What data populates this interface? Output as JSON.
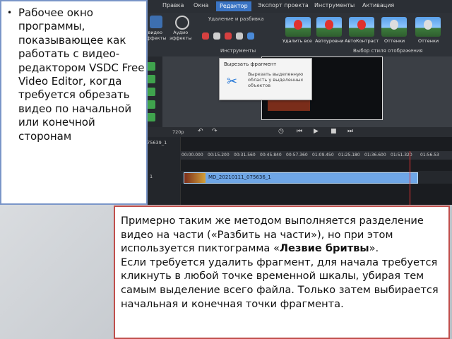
{
  "app": {
    "menu": [
      {
        "label": "Правка",
        "active": false
      },
      {
        "label": "Окна",
        "active": false
      },
      {
        "label": "Редактор",
        "active": true
      },
      {
        "label": "Экспорт проекта",
        "active": false
      },
      {
        "label": "Инструменты",
        "active": false
      },
      {
        "label": "Активация",
        "active": false
      }
    ],
    "ribbon": {
      "video_effects": "видео\nэффекты",
      "audio_effects": "Аудио\nэффекты",
      "delete_split": "Удаление и разбивка",
      "tools_label": "Инструменты",
      "styles_label": "Выбор стиля отображения",
      "styles": [
        "Удалить все",
        "Автоуровни",
        "АвтоКонтраст",
        "Оттенки",
        "Оттенки"
      ]
    },
    "tooltip": {
      "title": "Вырезать фрагмент",
      "body": "Вырезать выделенную область у выделенных объектов"
    },
    "transport": {
      "quality": "720p",
      "position": "075639_1"
    },
    "timeline": {
      "ticks": [
        "00:00.000",
        "00:15.200",
        "00:31.560",
        "00:45.840",
        "00:57.360",
        "01:09.450",
        "01:25.180",
        "01:36.600",
        "01:51.320",
        "01:56.53"
      ],
      "track_label": "1",
      "clip_name": "MD_20210111_075636_1"
    }
  },
  "left_box": {
    "bullet": "•",
    "text": "Рабочее окно программы, показывающее как работать с видео-редактором VSDC Free Video Editor, когда требуется обрезать видео по начальной или конечной сторонам"
  },
  "right_box": {
    "p1_before": "Примерно таким же методом выполняется разделение видео на части («Разбить на части»), но при этом используется пиктограмма «",
    "p1_bold": "Лезвие бритвы",
    "p1_after": "».",
    "p2": "Если требуется удалить фрагмент, для начала требуется кликнуть в любой точке временной шкалы, убирая тем самым выделение всего файла. Только затем выбирается начальная и конечная точки фрагмента."
  }
}
